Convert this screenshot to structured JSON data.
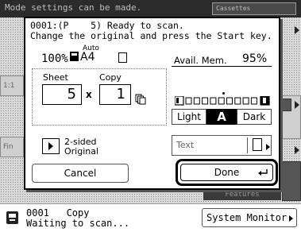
{
  "background": {
    "top_message": "Mode settings can be made.",
    "top_box_text": "Cassettes",
    "left_labels": [
      "1:1",
      "Fin"
    ],
    "right_label": "Features"
  },
  "dialog": {
    "message_line1": "0001:(P    5) Ready to scan.",
    "message_line2": "Change the original and press the Start key.",
    "copy_ratio": "100%",
    "paper_size_mode": "Auto",
    "paper_size": "A4",
    "avail_mem_label": "Avail. Mem.",
    "avail_mem_value": "95%",
    "sheet_label": "Sheet",
    "copy_label": "Copy",
    "sheet_value": "5",
    "times_sign": "x",
    "copy_value": "1",
    "density": {
      "light_label": "Light",
      "auto_label": "A",
      "dark_label": "Dark",
      "selected_level": 5,
      "total_levels": 9
    },
    "two_sided_line1": "2-sided",
    "two_sided_line2": "Original",
    "original_type": "Text",
    "cancel_label": "Cancel",
    "done_label": "Done"
  },
  "status": {
    "job_line": "0001   Copy",
    "state_line": "Waiting to scan...",
    "system_monitor_label": "System Monitor"
  },
  "icons": {
    "status": "printer-icon",
    "done": "enter-icon",
    "paper": "paper-icon",
    "orientation": "portrait-orientation-icon"
  }
}
